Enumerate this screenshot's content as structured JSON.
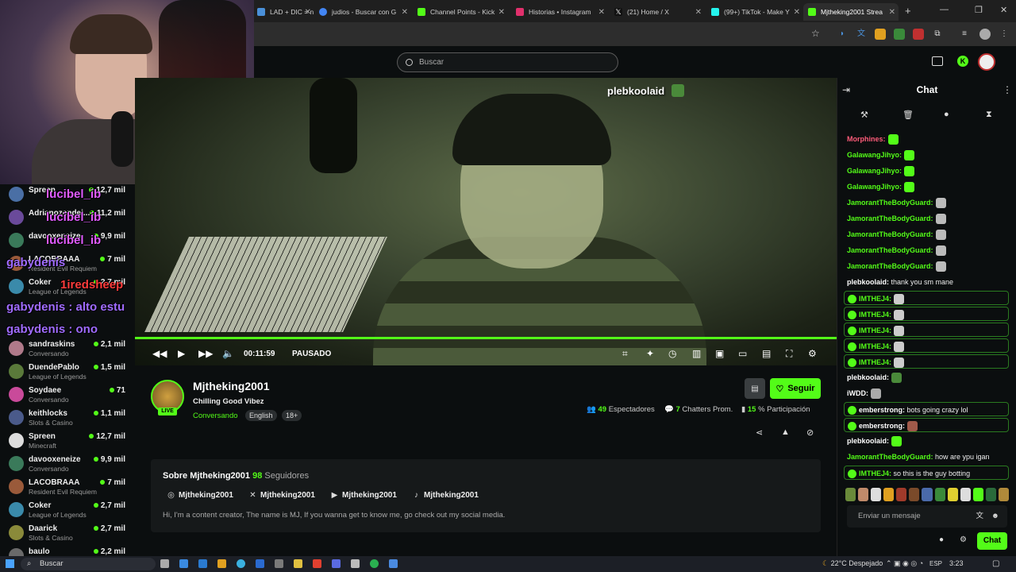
{
  "browser": {
    "tabs": [
      {
        "label": "LAD + DIC = n",
        "color": "#4a90d9"
      },
      {
        "label": "judios - Buscar con G",
        "color": "#4285f4"
      },
      {
        "label": "Channel Points - Kick",
        "color": "#53fc18"
      },
      {
        "label": "Historias • Instagram",
        "color": "#e1306c"
      },
      {
        "label": "(21) Home / X",
        "color": "#ffffff"
      },
      {
        "label": "(99+) TikTok - Make Y",
        "color": "#25f4ee"
      },
      {
        "label": "Mjtheking2001 Strea",
        "color": "#53fc18"
      }
    ],
    "new_tab": "+"
  },
  "header": {
    "search_placeholder": "Buscar"
  },
  "overlay": {
    "lines": [
      {
        "text": "lucibel_ib",
        "color": "#e05cff"
      },
      {
        "text": "lucibel_ib",
        "color": "#e05cff"
      },
      {
        "text": "lucibel_ib",
        "color": "#e05cff"
      },
      {
        "text": "gabydenis",
        "color": "#a06cff"
      },
      {
        "text": "1iredsheep",
        "color": "#ff3c3c"
      },
      {
        "text": "gabydenis : alto estu",
        "color": "#a06cff"
      },
      {
        "text": "gabydenis : ono",
        "color": "#a06cff"
      }
    ]
  },
  "sidebar": {
    "channels": [
      {
        "name": "Spreen",
        "category": "",
        "viewers": "12,7 mil",
        "color": "#4a6fa5"
      },
      {
        "name": "Adrianozendej...",
        "category": "",
        "viewers": "11,2 mil",
        "color": "#6a4a9a"
      },
      {
        "name": "davooxeneize",
        "category": "",
        "viewers": "9,9 mil",
        "color": "#3a7a5a"
      },
      {
        "name": "LACOBRAAA",
        "category": "Resident Evil Requiem",
        "viewers": "7 mil",
        "color": "#9a5a3a"
      },
      {
        "name": "Coker",
        "category": "League of Legends",
        "viewers": "2,7 mil",
        "color": "#3a8aaa"
      },
      {
        "name": "Daarick",
        "category": "",
        "viewers": "",
        "color": "#8a8a3a"
      },
      {
        "name": "sandraskins",
        "category": "Conversando",
        "viewers": "2,1 mil",
        "color": "#b07a8a"
      },
      {
        "name": "DuendePablo",
        "category": "League of Legends",
        "viewers": "1,5 mil",
        "color": "#5a7a3a"
      },
      {
        "name": "Soydaee",
        "category": "Conversando",
        "viewers": "71",
        "color": "#c94a9a"
      },
      {
        "name": "keithlocks",
        "category": "Slots & Casino",
        "viewers": "1,1 mil",
        "color": "#4a5a8a"
      },
      {
        "name": "Spreen",
        "category": "Minecraft",
        "viewers": "12,7 mil",
        "color": "#dddddd"
      },
      {
        "name": "davooxeneize",
        "category": "Conversando",
        "viewers": "9,9 mil",
        "color": "#3a7a5a"
      },
      {
        "name": "LACOBRAAA",
        "category": "Resident Evil Requiem",
        "viewers": "7 mil",
        "color": "#9a5a3a"
      },
      {
        "name": "Coker",
        "category": "League of Legends",
        "viewers": "2,7 mil",
        "color": "#3a8aaa"
      },
      {
        "name": "Daarick",
        "category": "Slots & Casino",
        "viewers": "2,7 mil",
        "color": "#8a8a3a"
      },
      {
        "name": "baulo",
        "category": "",
        "viewers": "2,2 mil",
        "color": "#6a6a6a"
      }
    ]
  },
  "player": {
    "overlay_name": "plebkoolaid",
    "time": "00:11:59",
    "status": "PAUSADO",
    "progress": 1.0
  },
  "stream": {
    "channel": "Mjtheking2001",
    "live_badge": "LIVE",
    "title": "Chilling Good Vibez",
    "category": "Conversando",
    "tags": [
      "English",
      "18+"
    ],
    "follow": "Seguir",
    "viewers_num": "49",
    "viewers_lbl": "Espectadores",
    "chatters_num": "7",
    "chatters_lbl": "Chatters Prom.",
    "part_num": "15",
    "part_lbl": "% Participación"
  },
  "about": {
    "title": "Sobre Mjtheking2001",
    "followers_num": "98",
    "followers_lbl": "Seguidores",
    "socials": [
      "Mjtheking2001",
      "Mjtheking2001",
      "Mjtheking2001",
      "Mjtheking2001"
    ],
    "bio": "Hi, I'm a content creator, The name is MJ, If you wanna get to know me, go check out my social media."
  },
  "chat": {
    "title": "Chat",
    "messages": [
      {
        "user": "Morphines:",
        "text": "",
        "color": "#ff5c7a",
        "emote": "#53fc18",
        "hl": false
      },
      {
        "user": "GalawangJihyo:",
        "text": "",
        "color": "#53fc18",
        "emote": "#53fc18",
        "hl": false
      },
      {
        "user": "GalawangJihyo:",
        "text": "",
        "color": "#53fc18",
        "emote": "#53fc18",
        "hl": false
      },
      {
        "user": "GalawangJihyo:",
        "text": "",
        "color": "#53fc18",
        "emote": "#53fc18",
        "hl": false
      },
      {
        "user": "JamorantTheBodyGuard:",
        "text": "",
        "color": "#53fc18",
        "emote": "#bbbbbb",
        "hl": false
      },
      {
        "user": "JamorantTheBodyGuard:",
        "text": "",
        "color": "#53fc18",
        "emote": "#bbbbbb",
        "hl": false
      },
      {
        "user": "JamorantTheBodyGuard:",
        "text": "",
        "color": "#53fc18",
        "emote": "#bbbbbb",
        "hl": false
      },
      {
        "user": "JamorantTheBodyGuard:",
        "text": "",
        "color": "#53fc18",
        "emote": "#bbbbbb",
        "hl": false
      },
      {
        "user": "JamorantTheBodyGuard:",
        "text": "",
        "color": "#53fc18",
        "emote": "#bbbbbb",
        "hl": false
      },
      {
        "user": "plebkoolaid:",
        "text": " thank you sm mane",
        "color": "#ffffff",
        "emote": "",
        "hl": false
      },
      {
        "user": "IMTHEJ4:",
        "text": "",
        "color": "#53fc18",
        "emote": "#cccccc",
        "hl": true
      },
      {
        "user": "IMTHEJ4:",
        "text": "",
        "color": "#53fc18",
        "emote": "#cccccc",
        "hl": true
      },
      {
        "user": "IMTHEJ4:",
        "text": "",
        "color": "#53fc18",
        "emote": "#cccccc",
        "hl": true
      },
      {
        "user": "IMTHEJ4:",
        "text": "",
        "color": "#53fc18",
        "emote": "#cccccc",
        "hl": true
      },
      {
        "user": "IMTHEJ4:",
        "text": "",
        "color": "#53fc18",
        "emote": "#cccccc",
        "hl": true
      },
      {
        "user": "plebkoolaid:",
        "text": "",
        "color": "#ffffff",
        "emote": "#4a8a3a",
        "hl": false
      },
      {
        "user": "iWDD:",
        "text": "",
        "color": "#ffffff",
        "emote": "#aaaaaa",
        "hl": false
      },
      {
        "user": "emberstrong:",
        "text": " bots going crazy lol",
        "color": "#ffffff",
        "emote": "",
        "hl": true
      },
      {
        "user": "emberstrong:",
        "text": "",
        "color": "#ffffff",
        "emote": "#a05a4a",
        "hl": true
      },
      {
        "user": "plebkoolaid:",
        "text": "",
        "color": "#ffffff",
        "emote": "#53fc18",
        "hl": false
      },
      {
        "user": "JamorantTheBodyGuard:",
        "text": " how are ypu igan",
        "color": "#53fc18",
        "emote": "",
        "hl": false
      },
      {
        "user": "IMTHEJ4:",
        "text": " so this is the guy botting",
        "color": "#53fc18",
        "emote": "",
        "hl": true
      }
    ],
    "emote_colors": [
      "#6a8a3a",
      "#c08a6a",
      "#dddddd",
      "#e0a020",
      "#a03a2a",
      "#7a4a2a",
      "#4a6aaa",
      "#3a8a3a",
      "#e0d030",
      "#dddddd",
      "#53fc18",
      "#2a6a3a",
      "#b08a3a"
    ],
    "input_placeholder": "Enviar un mensaje",
    "send_label": "Chat"
  },
  "taskbar": {
    "search": "Buscar",
    "weather": "22°C  Despejado",
    "lang": "ESP",
    "time": "3:23"
  }
}
